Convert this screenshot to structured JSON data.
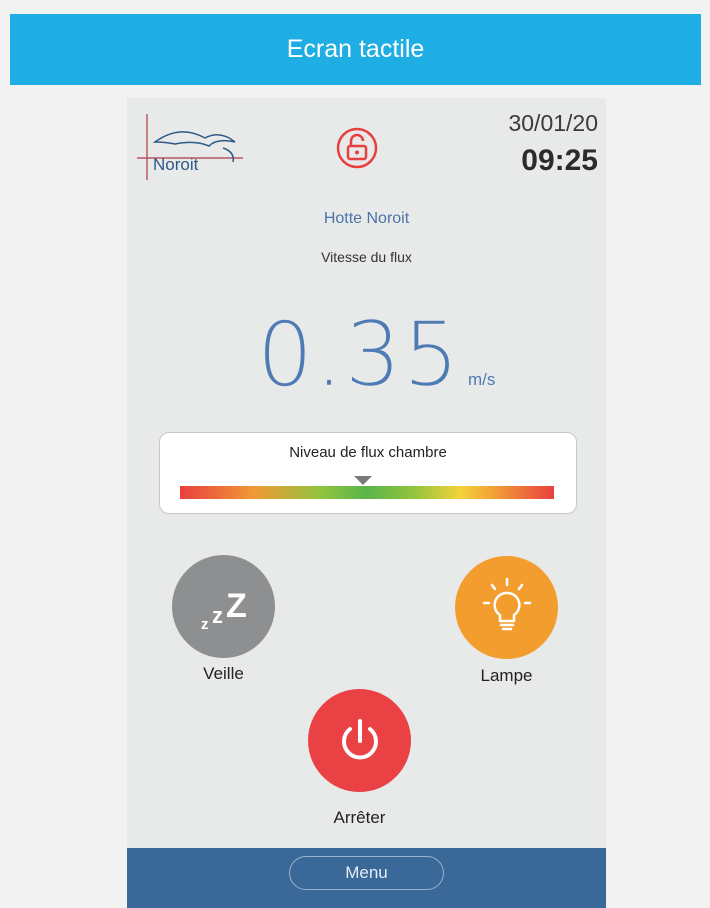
{
  "banner": {
    "title": "Ecran tactile"
  },
  "header": {
    "logo_text": "Noroit",
    "lock_icon": "padlock-open-icon",
    "date": "30/01/20",
    "time": "09:25"
  },
  "status": {
    "device_name": "Hotte Noroit",
    "flow_label": "Vitesse du flux",
    "flow_value": "0.35",
    "flow_unit": "m/s"
  },
  "level_indicator": {
    "title": "Niveau de flux chambre",
    "pointer_fraction": 0.49
  },
  "buttons": {
    "veille": {
      "label": "Veille",
      "icon": "sleep-zzz-icon",
      "color": "#8e8f91"
    },
    "lampe": {
      "label": "Lampe",
      "icon": "light-bulb-icon",
      "color": "#f39d2e"
    },
    "stop": {
      "label": "Arrêter",
      "icon": "power-icon",
      "color": "#ea4145"
    }
  },
  "menu": {
    "label": "Menu"
  },
  "colors": {
    "banner": "#1eaee3",
    "accent_blue": "#4f7bb4",
    "lock_red": "#e8403f",
    "bottom_bar": "#3a6898"
  }
}
